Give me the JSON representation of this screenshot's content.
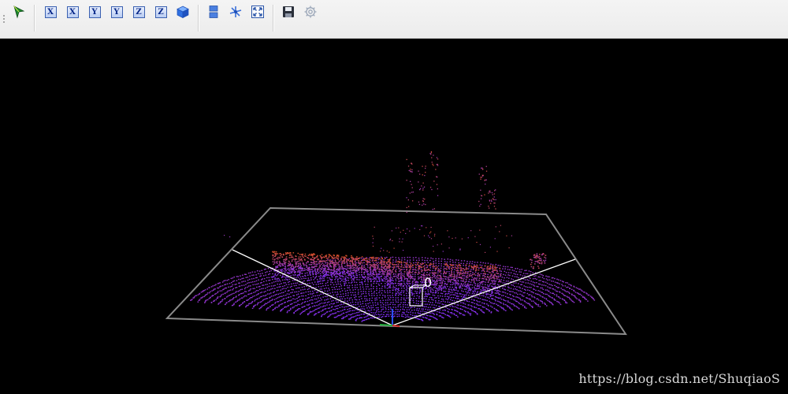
{
  "toolbar": {
    "buttons": [
      {
        "name": "pointer-tool-icon"
      },
      {
        "name": "view-x-positive-icon",
        "letter": "X"
      },
      {
        "name": "view-x-negative-icon",
        "letter": "X"
      },
      {
        "name": "view-y-positive-icon",
        "letter": "Y"
      },
      {
        "name": "view-y-negative-icon",
        "letter": "Y"
      },
      {
        "name": "view-z-positive-icon",
        "letter": "Z"
      },
      {
        "name": "view-z-negative-icon",
        "letter": "Z"
      },
      {
        "name": "perspective-cube-icon"
      },
      {
        "name": "split-view-icon"
      },
      {
        "name": "move-axes-icon"
      },
      {
        "name": "fit-all-icon"
      },
      {
        "name": "save-icon"
      },
      {
        "name": "settings-gear-icon"
      }
    ]
  },
  "viewport": {
    "object_label": "0",
    "colors": {
      "background": "#000000",
      "ground_grid": "#8a8a8a",
      "fov_lines": "#ffffff",
      "near_points": "#7a2cff",
      "far_points": "#d8501a",
      "box": "#ffffff"
    }
  },
  "watermark": "https://blog.csdn.net/ShuqiaoS"
}
